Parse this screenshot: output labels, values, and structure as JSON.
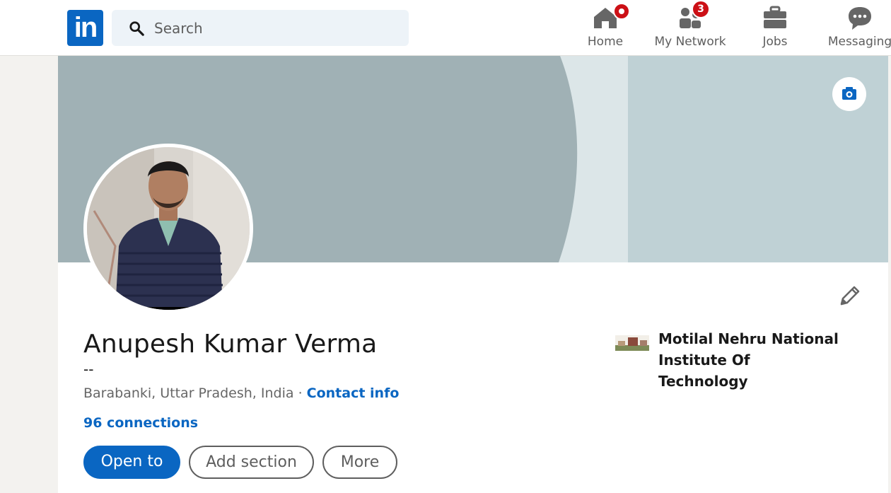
{
  "header": {
    "logo_text": "in",
    "search_placeholder": "Search",
    "nav": [
      {
        "label": "Home",
        "icon": "home-icon",
        "badge": ""
      },
      {
        "label": "My Network",
        "icon": "network-icon",
        "badge": "3"
      },
      {
        "label": "Jobs",
        "icon": "briefcase-icon",
        "badge": ""
      },
      {
        "label": "Messaging",
        "icon": "messaging-icon",
        "badge": ""
      }
    ]
  },
  "profile": {
    "name": "Anupesh Kumar Verma",
    "headline": "--",
    "location": "Barabanki, Uttar Pradesh, India",
    "separator": "·",
    "contact_info": "Contact info",
    "connections": "96 connections",
    "school": "Motilal Nehru National Institute Of Technology"
  },
  "actions": {
    "open_to": "Open to",
    "add_section": "Add section",
    "more": "More"
  },
  "colors": {
    "brand": "#0a66c2",
    "badge": "#cc1016",
    "cover": "#a0b1b5"
  }
}
